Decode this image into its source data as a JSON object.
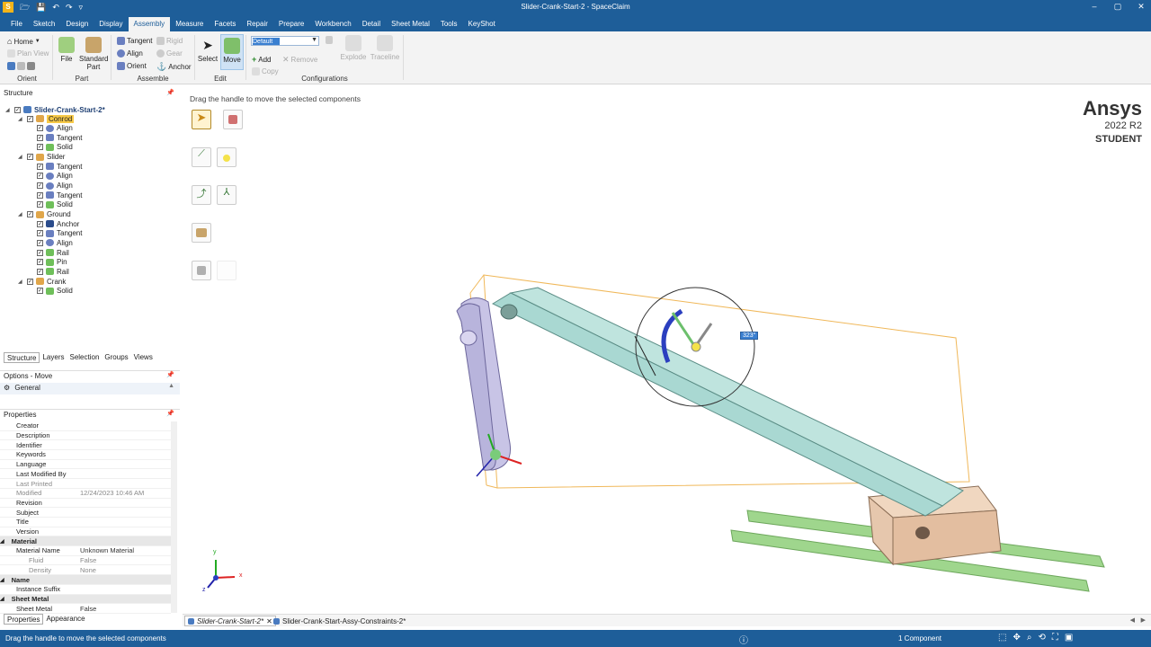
{
  "window": {
    "title": "Slider-Crank-Start-2 - SpaceClaim"
  },
  "qat": {
    "logo": "S",
    "icons": [
      "open-icon",
      "save-icon",
      "undo-icon",
      "redo-icon",
      "more-icon"
    ],
    "glyphs": [
      "🗁",
      "💾",
      "↶",
      "↷",
      "▿"
    ]
  },
  "win_controls": {
    "minimize": "–",
    "maximize": "▢",
    "close": "✕"
  },
  "menu_tabs": [
    "File",
    "Sketch",
    "Design",
    "Display",
    "Assembly",
    "Measure",
    "Facets",
    "Repair",
    "Prepare",
    "Workbench",
    "Detail",
    "Sheet Metal",
    "Tools",
    "KeyShot"
  ],
  "active_tab": "Assembly",
  "ribbon": {
    "orient": {
      "home": "Home",
      "plan_view": "Plan View",
      "label": "Orient"
    },
    "part": {
      "file": "File",
      "standard_part_1": "Standard",
      "standard_part_2": "Part",
      "label": "Part"
    },
    "assemble": {
      "tangent": "Tangent",
      "rigid": "Rigid",
      "align": "Align",
      "gear": "Gear",
      "orient": "Orient",
      "anchor": "Anchor",
      "label": "Assemble"
    },
    "edit": {
      "select": "Select",
      "move": "Move",
      "label": "Edit"
    },
    "configurations": {
      "current": "Default",
      "add": "Add",
      "remove": "Remove",
      "copy": "Copy",
      "explode": "Explode",
      "traceline": "Traceline",
      "label": "Configurations"
    }
  },
  "structure": {
    "title": "Structure",
    "root": "Slider-Crank-Start-2*",
    "nodes": [
      {
        "label": "Conrod",
        "level": 1,
        "type": "component",
        "highlight": true
      },
      {
        "label": "Align",
        "level": 2,
        "type": "align"
      },
      {
        "label": "Tangent",
        "level": 2,
        "type": "tangent"
      },
      {
        "label": "Solid",
        "level": 2,
        "type": "solid"
      },
      {
        "label": "Slider",
        "level": 1,
        "type": "component"
      },
      {
        "label": "Tangent",
        "level": 2,
        "type": "tangent"
      },
      {
        "label": "Align",
        "level": 2,
        "type": "align"
      },
      {
        "label": "Align",
        "level": 2,
        "type": "align"
      },
      {
        "label": "Tangent",
        "level": 2,
        "type": "tangent"
      },
      {
        "label": "Solid",
        "level": 2,
        "type": "solid"
      },
      {
        "label": "Ground",
        "level": 1,
        "type": "component"
      },
      {
        "label": "Anchor",
        "level": 2,
        "type": "anchor"
      },
      {
        "label": "Tangent",
        "level": 2,
        "type": "tangent"
      },
      {
        "label": "Align",
        "level": 2,
        "type": "align"
      },
      {
        "label": "Rail",
        "level": 2,
        "type": "solid"
      },
      {
        "label": "Pin",
        "level": 2,
        "type": "solid"
      },
      {
        "label": "Rail",
        "level": 2,
        "type": "solid"
      },
      {
        "label": "Crank",
        "level": 1,
        "type": "component"
      },
      {
        "label": "Solid",
        "level": 2,
        "type": "solid"
      }
    ]
  },
  "panel_tabs": [
    "Structure",
    "Layers",
    "Selection",
    "Groups",
    "Views"
  ],
  "options": {
    "title": "Options - Move",
    "general": "General"
  },
  "properties": {
    "title": "Properties",
    "rows": [
      {
        "name": "Creator",
        "value": "",
        "kind": "row"
      },
      {
        "name": "Description",
        "value": "",
        "kind": "row"
      },
      {
        "name": "Identifier",
        "value": "",
        "kind": "row"
      },
      {
        "name": "Keywords",
        "value": "",
        "kind": "row"
      },
      {
        "name": "Language",
        "value": "",
        "kind": "row"
      },
      {
        "name": "Last Modified By",
        "value": "",
        "kind": "row"
      },
      {
        "name": "Last Printed",
        "value": "",
        "kind": "grey"
      },
      {
        "name": "Modified",
        "value": "12/24/2023 10:46 AM",
        "kind": "grey"
      },
      {
        "name": "Revision",
        "value": "",
        "kind": "row"
      },
      {
        "name": "Subject",
        "value": "",
        "kind": "row"
      },
      {
        "name": "Title",
        "value": "",
        "kind": "row"
      },
      {
        "name": "Version",
        "value": "",
        "kind": "row"
      },
      {
        "name": "Material",
        "value": "",
        "kind": "sect"
      },
      {
        "name": "Material Name",
        "value": "Unknown Material",
        "kind": "row"
      },
      {
        "name": "Fluid",
        "value": "False",
        "kind": "subgrey"
      },
      {
        "name": "Density",
        "value": "None",
        "kind": "subgrey"
      },
      {
        "name": "Name",
        "value": "",
        "kind": "sect"
      },
      {
        "name": "Instance Suffix",
        "value": "",
        "kind": "row"
      },
      {
        "name": "Sheet Metal",
        "value": "",
        "kind": "sect"
      },
      {
        "name": "Sheet Metal",
        "value": "False",
        "kind": "row"
      }
    ]
  },
  "bottom_tabs": [
    "Properties",
    "Appearance"
  ],
  "viewport": {
    "hint": "Drag the handle to move the selected components",
    "brand": {
      "name": "Ansys",
      "version": "2022 R2",
      "edition": "STUDENT"
    },
    "angle_readout": "323°",
    "triad": {
      "x": "x",
      "y": "y",
      "z": "z"
    }
  },
  "doc_tabs": [
    {
      "label": "Slider-Crank-Start-2*",
      "active": true
    },
    {
      "label": "Slider-Crank-Start-Assy-Constraints-2*",
      "active": false
    }
  ],
  "status": {
    "message": "Drag the handle to move the selected components",
    "count": "1 Component",
    "info_icon": "ⓘ"
  },
  "colors": {
    "accent": "#1e5e99",
    "conrod": "#a9d8d2",
    "crank": "#b8b4dc",
    "slider": "#e6c7ad",
    "rail": "#9fd68d",
    "bbox": "#f0b85a"
  }
}
